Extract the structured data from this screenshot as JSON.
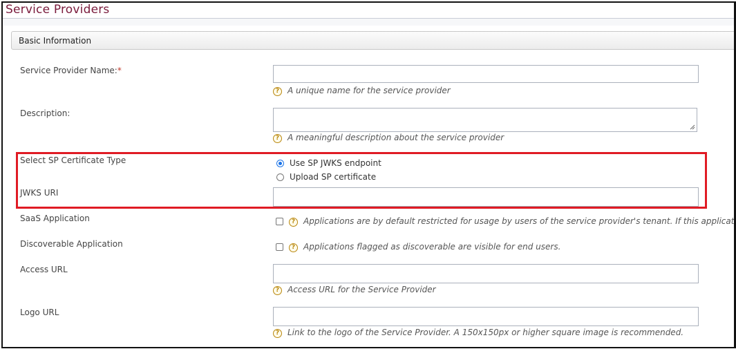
{
  "page": {
    "title": "Service Providers"
  },
  "section": {
    "title": "Basic Information"
  },
  "fields": {
    "sp_name": {
      "label": "Service Provider Name:",
      "required_mark": "*",
      "value": "",
      "hint": "A unique name for the service provider"
    },
    "description": {
      "label": "Description:",
      "value": "",
      "hint": "A meaningful description about the service provider"
    },
    "cert_type": {
      "label": "Select SP Certificate Type",
      "options": [
        {
          "label": "Use SP JWKS endpoint",
          "selected": true
        },
        {
          "label": "Upload SP certificate",
          "selected": false
        }
      ]
    },
    "jwks_uri": {
      "label": "JWKS URI",
      "value": ""
    },
    "saas": {
      "label": "SaaS Application",
      "checked": false,
      "hint": "Applications are by default restricted for usage by users of the service provider's tenant. If this application"
    },
    "discoverable": {
      "label": "Discoverable Application",
      "checked": false,
      "hint": "Applications flagged as discoverable are visible for end users."
    },
    "access_url": {
      "label": "Access URL",
      "value": "",
      "hint": "Access URL for the Service Provider"
    },
    "logo_url": {
      "label": "Logo URL",
      "value": "",
      "hint": "Link to the logo of the Service Provider. A 150x150px or higher square image is recommended."
    }
  },
  "icons": {
    "help": "help-icon",
    "help_glyph": "?"
  },
  "colors": {
    "title": "#7a1b3c",
    "highlight": "#e01b24",
    "radio_selected": "#1a73e8",
    "help_icon": "#b8860b"
  }
}
